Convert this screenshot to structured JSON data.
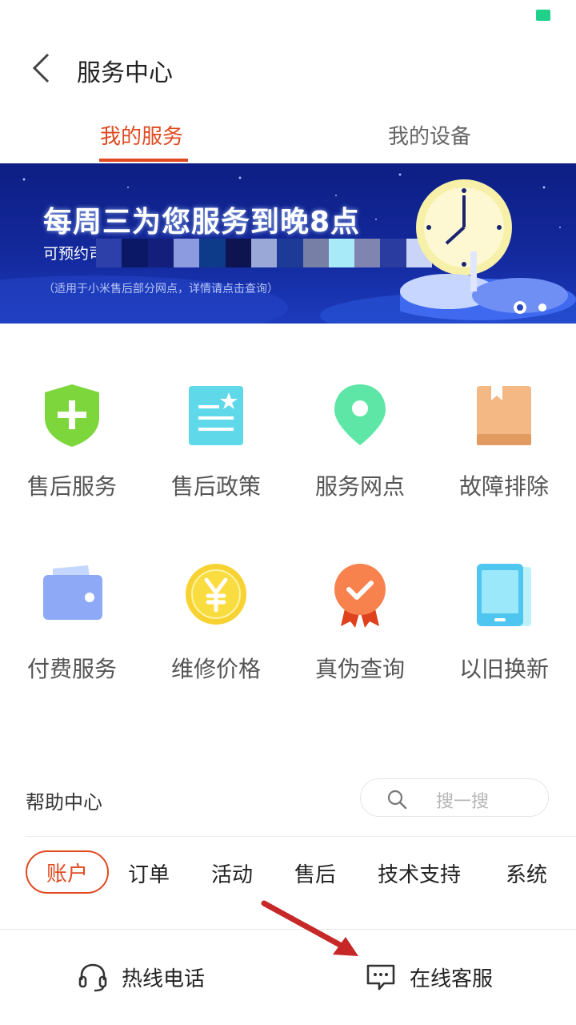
{
  "status": {
    "battery_color": "#1fd18b"
  },
  "header": {
    "title": "服务中心",
    "back_icon": "chevron-left-icon"
  },
  "tabs": [
    {
      "label": "我的服务",
      "active": true
    },
    {
      "label": "我的设备",
      "active": false
    }
  ],
  "banner": {
    "headline": "每周三为您服务到晚8点",
    "subtitle": "可预约司",
    "note": "（适用于小米售后部分网点，详情请点击查询）"
  },
  "services": [
    {
      "label": "售后服务",
      "icon": "shield-plus-icon"
    },
    {
      "label": "售后政策",
      "icon": "document-star-icon"
    },
    {
      "label": "服务网点",
      "icon": "location-pin-icon"
    },
    {
      "label": "故障排除",
      "icon": "book-icon"
    },
    {
      "label": "付费服务",
      "icon": "wallet-icon"
    },
    {
      "label": "维修价格",
      "icon": "yen-coin-icon"
    },
    {
      "label": "真伪查询",
      "icon": "badge-check-icon"
    },
    {
      "label": "以旧换新",
      "icon": "tablet-icon"
    }
  ],
  "help": {
    "title": "帮助中心",
    "search_placeholder": "搜一搜",
    "search_icon": "search-icon"
  },
  "categories": [
    "账户",
    "订单",
    "活动",
    "售后",
    "技术支持",
    "系统"
  ],
  "footer": {
    "hotline": "热线电话",
    "hotline_icon": "headset-icon",
    "online": "在线客服",
    "online_icon": "chat-bubble-icon"
  },
  "colors": {
    "accent": "#e04a21",
    "arrow": "#c62828"
  }
}
